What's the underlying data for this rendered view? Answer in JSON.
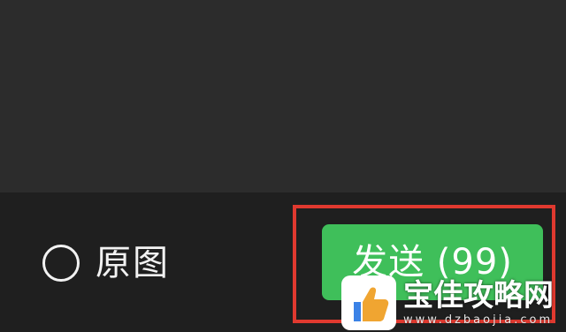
{
  "toolbar": {
    "original_label": "原图",
    "radio_icon": "radio-unchecked-icon",
    "send_label": "发送 (99)",
    "send_color": "#3fbf5a",
    "highlight_color": "#e0392f"
  },
  "watermark": {
    "name": "宝佳攻略网",
    "url": "www.dzbaojia.com",
    "logo_icon": "thumbs-up-icon"
  }
}
